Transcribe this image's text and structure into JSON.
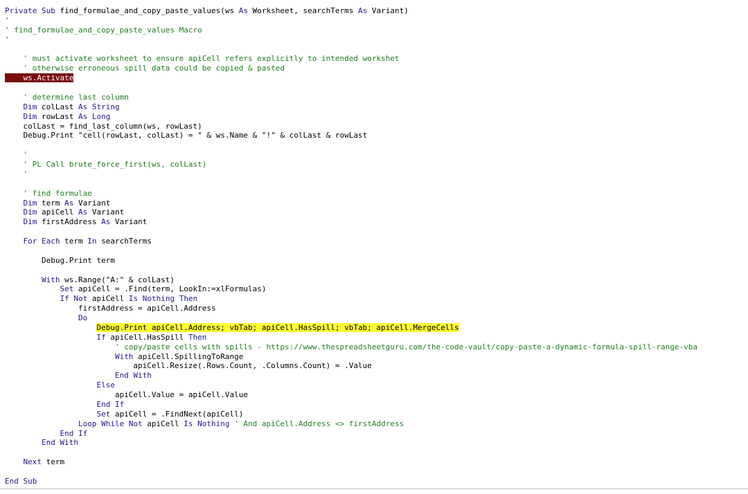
{
  "code": {
    "lines": [
      {
        "segments": [
          {
            "t": "Private Sub",
            "s": "k"
          },
          {
            "t": " find_formulae_and_copy_paste_values(ws ",
            "s": "p"
          },
          {
            "t": "As",
            "s": "k"
          },
          {
            "t": " Worksheet, searchTerms ",
            "s": "p"
          },
          {
            "t": "As",
            "s": "k"
          },
          {
            "t": " Variant)",
            "s": "p"
          }
        ]
      },
      {
        "segments": [
          {
            "t": "'",
            "s": "c"
          }
        ]
      },
      {
        "segments": [
          {
            "t": "' find_formulae_and_copy_paste_values Macro",
            "s": "c"
          }
        ]
      },
      {
        "segments": [
          {
            "t": "'",
            "s": "c"
          }
        ]
      },
      {
        "segments": []
      },
      {
        "segments": [
          {
            "t": "    ",
            "s": "p"
          },
          {
            "t": "' must activate worksheet to ensure apiCell refers explicitly to intended workshet",
            "s": "c"
          }
        ]
      },
      {
        "segments": [
          {
            "t": "    ",
            "s": "p"
          },
          {
            "t": "' otherwise erroneous spill data could be copied & pasted",
            "s": "c"
          }
        ]
      },
      {
        "segments": [
          {
            "t": "    ws.Activate",
            "s": "p",
            "h": "r"
          }
        ]
      },
      {
        "segments": []
      },
      {
        "segments": [
          {
            "t": "    ",
            "s": "p"
          },
          {
            "t": "' determine last column",
            "s": "c"
          }
        ]
      },
      {
        "segments": [
          {
            "t": "    ",
            "s": "p"
          },
          {
            "t": "Dim",
            "s": "k"
          },
          {
            "t": " colLast ",
            "s": "p"
          },
          {
            "t": "As String",
            "s": "k"
          }
        ]
      },
      {
        "segments": [
          {
            "t": "    ",
            "s": "p"
          },
          {
            "t": "Dim",
            "s": "k"
          },
          {
            "t": " rowLast ",
            "s": "p"
          },
          {
            "t": "As Long",
            "s": "k"
          }
        ]
      },
      {
        "segments": [
          {
            "t": "    colLast = find_last_column(ws, rowLast)",
            "s": "p"
          }
        ]
      },
      {
        "segments": [
          {
            "t": "    Debug.Print \"cell(rowLast, colLast) = \" & ws.Name & \"!\" & colLast & rowLast",
            "s": "p"
          }
        ]
      },
      {
        "segments": []
      },
      {
        "segments": [
          {
            "t": "    ",
            "s": "p"
          },
          {
            "t": "'",
            "s": "c"
          }
        ]
      },
      {
        "segments": [
          {
            "t": "    ",
            "s": "p"
          },
          {
            "t": "' PL Call brute_force_first(ws, colLast)",
            "s": "c"
          }
        ]
      },
      {
        "segments": [
          {
            "t": "    ",
            "s": "p"
          },
          {
            "t": "'",
            "s": "c"
          }
        ]
      },
      {
        "segments": []
      },
      {
        "segments": [
          {
            "t": "    ",
            "s": "p"
          },
          {
            "t": "' find formulae",
            "s": "c"
          }
        ]
      },
      {
        "segments": [
          {
            "t": "    ",
            "s": "p"
          },
          {
            "t": "Dim",
            "s": "k"
          },
          {
            "t": " term ",
            "s": "p"
          },
          {
            "t": "As",
            "s": "k"
          },
          {
            "t": " Variant",
            "s": "p"
          }
        ]
      },
      {
        "segments": [
          {
            "t": "    ",
            "s": "p"
          },
          {
            "t": "Dim",
            "s": "k"
          },
          {
            "t": " apiCell ",
            "s": "p"
          },
          {
            "t": "As",
            "s": "k"
          },
          {
            "t": " Variant",
            "s": "p"
          }
        ]
      },
      {
        "segments": [
          {
            "t": "    ",
            "s": "p"
          },
          {
            "t": "Dim",
            "s": "k"
          },
          {
            "t": " firstAddress ",
            "s": "p"
          },
          {
            "t": "As",
            "s": "k"
          },
          {
            "t": " Variant",
            "s": "p"
          }
        ]
      },
      {
        "segments": []
      },
      {
        "segments": [
          {
            "t": "    ",
            "s": "p"
          },
          {
            "t": "For Each",
            "s": "k"
          },
          {
            "t": " term ",
            "s": "p"
          },
          {
            "t": "In",
            "s": "k"
          },
          {
            "t": " searchTerms",
            "s": "p"
          }
        ]
      },
      {
        "segments": []
      },
      {
        "segments": [
          {
            "t": "        Debug.Print term",
            "s": "p"
          }
        ]
      },
      {
        "segments": []
      },
      {
        "segments": [
          {
            "t": "        ",
            "s": "p"
          },
          {
            "t": "With",
            "s": "k"
          },
          {
            "t": " ws.Range(\"A:\" & colLast)",
            "s": "p"
          }
        ]
      },
      {
        "segments": [
          {
            "t": "            ",
            "s": "p"
          },
          {
            "t": "Set",
            "s": "k"
          },
          {
            "t": " apiCell = .Find(term, LookIn:=xlFormulas)",
            "s": "p"
          }
        ]
      },
      {
        "segments": [
          {
            "t": "            ",
            "s": "p"
          },
          {
            "t": "If Not",
            "s": "k"
          },
          {
            "t": " apiCell ",
            "s": "p"
          },
          {
            "t": "Is Nothing Then",
            "s": "k"
          }
        ]
      },
      {
        "segments": [
          {
            "t": "                firstAddress = apiCell.Address",
            "s": "p"
          }
        ]
      },
      {
        "segments": [
          {
            "t": "                ",
            "s": "p"
          },
          {
            "t": "Do",
            "s": "k"
          }
        ]
      },
      {
        "segments": [
          {
            "t": "                    ",
            "s": "p"
          },
          {
            "t": "Debug.Print apiCell.Address; vbTab; apiCell.HasSpill; vbTab; apiCell.MergeCells",
            "s": "p",
            "h": "y"
          }
        ]
      },
      {
        "segments": [
          {
            "t": "                    ",
            "s": "p"
          },
          {
            "t": "If",
            "s": "k"
          },
          {
            "t": " apiCell.HasSpill ",
            "s": "p"
          },
          {
            "t": "Then",
            "s": "k"
          }
        ]
      },
      {
        "segments": [
          {
            "t": "                        ",
            "s": "p"
          },
          {
            "t": "' copy/paste cells with spills - https://www.thespreadsheetguru.com/the-code-vault/copy-paste-a-dynamic-formula-spill-range-vba",
            "s": "c"
          }
        ]
      },
      {
        "segments": [
          {
            "t": "                        ",
            "s": "p"
          },
          {
            "t": "With",
            "s": "k"
          },
          {
            "t": " apiCell.SpillingToRange",
            "s": "p"
          }
        ]
      },
      {
        "segments": [
          {
            "t": "                            apiCell.Resize(.Rows.Count, .Columns.Count) = .Value",
            "s": "p"
          }
        ]
      },
      {
        "segments": [
          {
            "t": "                        ",
            "s": "p"
          },
          {
            "t": "End With",
            "s": "k"
          }
        ]
      },
      {
        "segments": [
          {
            "t": "                    ",
            "s": "p"
          },
          {
            "t": "Else",
            "s": "k"
          }
        ]
      },
      {
        "segments": [
          {
            "t": "                        apiCell.Value = apiCell.Value",
            "s": "p"
          }
        ]
      },
      {
        "segments": [
          {
            "t": "                    ",
            "s": "p"
          },
          {
            "t": "End If",
            "s": "k"
          }
        ]
      },
      {
        "segments": [
          {
            "t": "                    ",
            "s": "p"
          },
          {
            "t": "Set",
            "s": "k"
          },
          {
            "t": " apiCell = .FindNext(apiCell)",
            "s": "p"
          }
        ]
      },
      {
        "segments": [
          {
            "t": "                ",
            "s": "p"
          },
          {
            "t": "Loop While Not",
            "s": "k"
          },
          {
            "t": " apiCell ",
            "s": "p"
          },
          {
            "t": "Is Nothing",
            "s": "k"
          },
          {
            "t": " ",
            "s": "p"
          },
          {
            "t": "' And apiCell.Address <> firstAddress",
            "s": "c"
          }
        ]
      },
      {
        "segments": [
          {
            "t": "            ",
            "s": "p"
          },
          {
            "t": "End If",
            "s": "k"
          }
        ]
      },
      {
        "segments": [
          {
            "t": "        ",
            "s": "p"
          },
          {
            "t": "End With",
            "s": "k"
          }
        ]
      },
      {
        "segments": []
      },
      {
        "segments": [
          {
            "t": "    ",
            "s": "p"
          },
          {
            "t": "Next",
            "s": "k"
          },
          {
            "t": " term",
            "s": "p"
          }
        ]
      },
      {
        "segments": []
      },
      {
        "segments": [
          {
            "t": "End Sub",
            "s": "k"
          }
        ]
      }
    ]
  },
  "colors": {
    "keyword": "#1a1a8c",
    "comment": "#1f7f1f",
    "plain": "#000000",
    "breakpoint_highlight": "#7a0c0c",
    "selection_highlight": "#ffff33",
    "background": "#ffffff"
  }
}
